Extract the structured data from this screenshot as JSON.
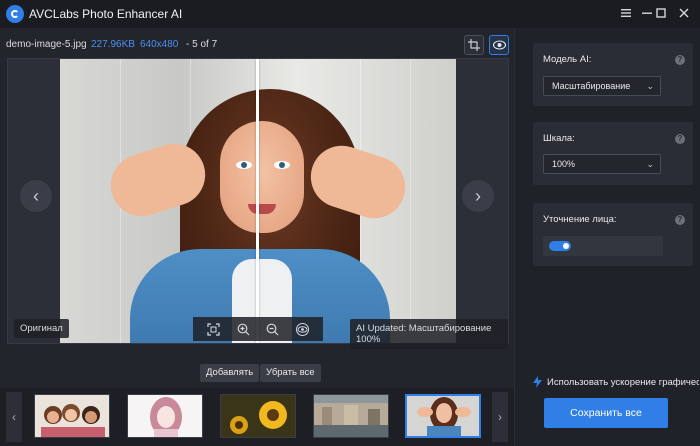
{
  "app": {
    "title": "AVCLabs Photo Enhancer AI",
    "accent_color": "#2f7fe6",
    "window_controls": [
      "menu-icon",
      "minimize-icon",
      "maximize-icon",
      "close-icon"
    ]
  },
  "file_info": {
    "name": "demo-image-5.jpg",
    "size": "227.96KB",
    "dimensions": "640x480",
    "position": "- 5 of 7"
  },
  "viewer": {
    "original_tag": "Оригинал",
    "status_tag": "AI Updated: Масштабирование 100%"
  },
  "actions": {
    "add_label": "Добавлять",
    "remove_all_label": "Убрать все"
  },
  "thumbnails": [
    {
      "name": "group-photo",
      "selected": false
    },
    {
      "name": "anime-girl",
      "selected": false
    },
    {
      "name": "sunflowers",
      "selected": false
    },
    {
      "name": "city-canal",
      "selected": false
    },
    {
      "name": "woman-peace-sign",
      "selected": true
    }
  ],
  "settings": {
    "model_label": "Модель AI:",
    "model_value": "Масштабирование",
    "scale_label": "Шкала:",
    "scale_value": "100%",
    "face_refine_label": "Уточнение лица:",
    "face_refine_enabled": true
  },
  "footer": {
    "gpu_label": "Использовать ускорение графичес...",
    "save_label": "Сохранить все"
  }
}
